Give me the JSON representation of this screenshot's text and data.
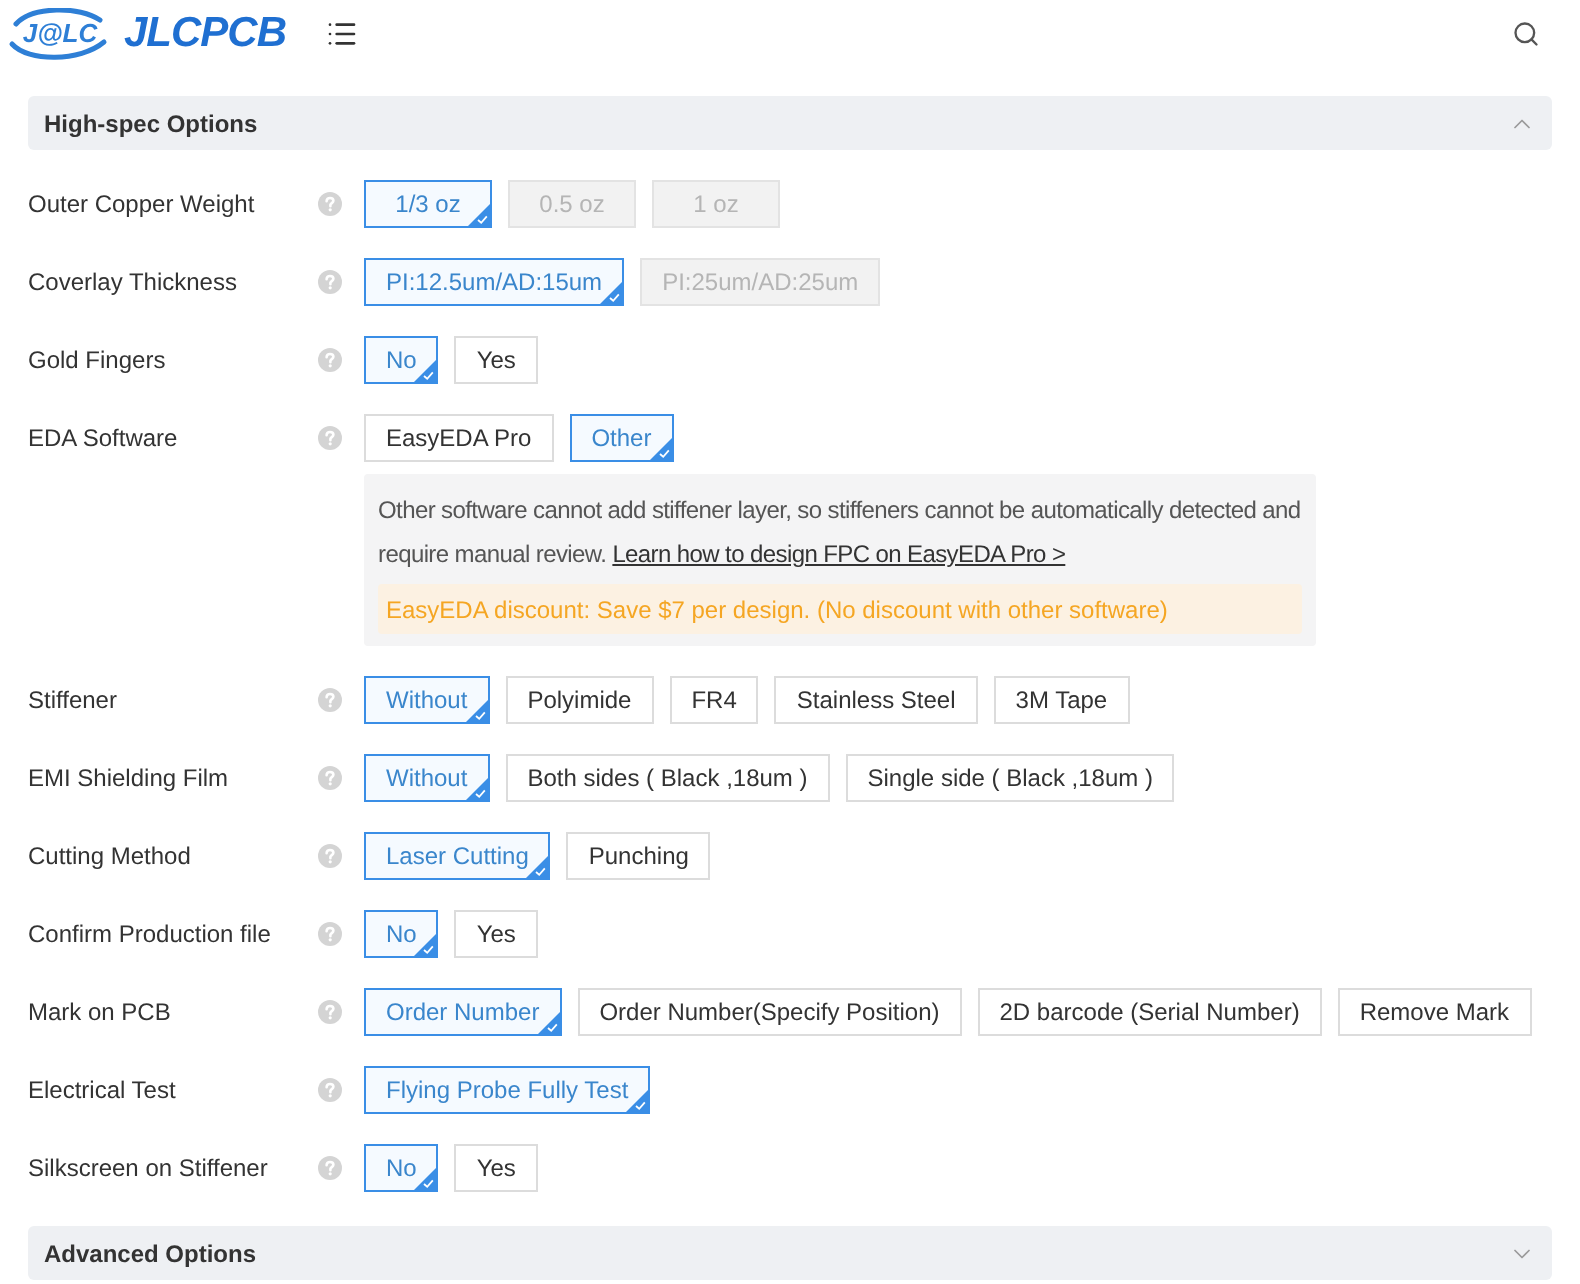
{
  "header": {
    "logo_mark": "J@LC",
    "logo_text": "JLCPCB"
  },
  "sections": [
    {
      "title": "High-spec Options",
      "expanded": true,
      "rows": [
        {
          "label": "Outer Copper Weight",
          "options": [
            {
              "label": "1/3 oz",
              "selected": true,
              "disabled": false
            },
            {
              "label": "0.5 oz",
              "selected": false,
              "disabled": true
            },
            {
              "label": "1 oz",
              "selected": false,
              "disabled": true
            }
          ]
        },
        {
          "label": "Coverlay Thickness",
          "options": [
            {
              "label": "PI:12.5um/AD:15um",
              "selected": true,
              "disabled": false
            },
            {
              "label": "PI:25um/AD:25um",
              "selected": false,
              "disabled": true
            }
          ]
        },
        {
          "label": "Gold Fingers",
          "options": [
            {
              "label": "No",
              "selected": true,
              "disabled": false
            },
            {
              "label": "Yes",
              "selected": false,
              "disabled": false
            }
          ]
        },
        {
          "label": "EDA Software",
          "options": [
            {
              "label": "EasyEDA Pro",
              "selected": false,
              "disabled": false
            },
            {
              "label": "Other",
              "selected": true,
              "disabled": false
            }
          ],
          "note": {
            "text": "Other software cannot add stiffener layer, so stiffeners cannot be automatically detected and require manual review.",
            "link": "Learn how to design FPC on EasyEDA Pro >",
            "discount": "EasyEDA discount: Save $7 per design. (No discount with other software)"
          }
        },
        {
          "label": "Stiffener",
          "options": [
            {
              "label": "Without",
              "selected": true,
              "disabled": false
            },
            {
              "label": "Polyimide",
              "selected": false,
              "disabled": false
            },
            {
              "label": "FR4",
              "selected": false,
              "disabled": false
            },
            {
              "label": "Stainless Steel",
              "selected": false,
              "disabled": false
            },
            {
              "label": "3M Tape",
              "selected": false,
              "disabled": false
            }
          ]
        },
        {
          "label": "EMI Shielding Film",
          "options": [
            {
              "label": "Without",
              "selected": true,
              "disabled": false
            },
            {
              "label": "Both sides ( Black ,18um )",
              "selected": false,
              "disabled": false
            },
            {
              "label": "Single side ( Black ,18um )",
              "selected": false,
              "disabled": false
            }
          ]
        },
        {
          "label": "Cutting Method",
          "options": [
            {
              "label": "Laser Cutting",
              "selected": true,
              "disabled": false
            },
            {
              "label": "Punching",
              "selected": false,
              "disabled": false
            }
          ]
        },
        {
          "label": "Confirm Production file",
          "options": [
            {
              "label": "No",
              "selected": true,
              "disabled": false
            },
            {
              "label": "Yes",
              "selected": false,
              "disabled": false
            }
          ]
        },
        {
          "label": "Mark on PCB",
          "options": [
            {
              "label": "Order Number",
              "selected": true,
              "disabled": false
            },
            {
              "label": "Order Number(Specify Position)",
              "selected": false,
              "disabled": false
            },
            {
              "label": "2D barcode (Serial Number)",
              "selected": false,
              "disabled": false
            },
            {
              "label": "Remove Mark",
              "selected": false,
              "disabled": false
            }
          ]
        },
        {
          "label": "Electrical Test",
          "options": [
            {
              "label": "Flying Probe Fully Test",
              "selected": true,
              "disabled": false
            }
          ]
        },
        {
          "label": "Silkscreen on Stiffener",
          "options": [
            {
              "label": "No",
              "selected": true,
              "disabled": false
            },
            {
              "label": "Yes",
              "selected": false,
              "disabled": false
            }
          ]
        }
      ]
    },
    {
      "title": "Advanced Options",
      "expanded": false
    }
  ]
}
